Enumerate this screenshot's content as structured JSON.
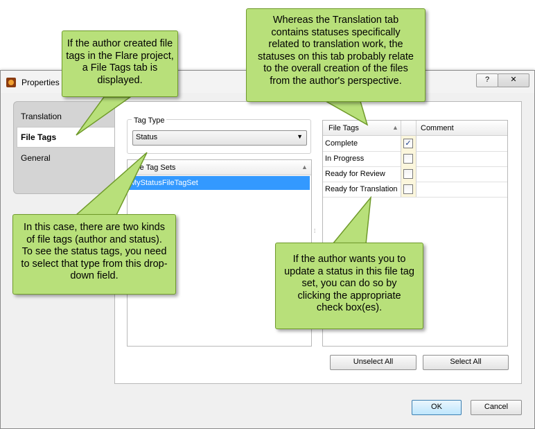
{
  "window": {
    "title": "Properties",
    "help_label": "?",
    "close_label": "✕"
  },
  "tabs": [
    {
      "label": "Translation"
    },
    {
      "label": "File Tags"
    },
    {
      "label": "General"
    }
  ],
  "tag_type": {
    "legend": "Tag Type",
    "selected": "Status"
  },
  "file_tag_sets": {
    "header": "File Tag Sets",
    "items": [
      "MyStatusFileTagSet"
    ]
  },
  "file_tags_table": {
    "col_tags": "File Tags",
    "col_comment": "Comment",
    "rows": [
      {
        "name": "Complete",
        "checked": true
      },
      {
        "name": "In Progress",
        "checked": false
      },
      {
        "name": "Ready for Review",
        "checked": false
      },
      {
        "name": "Ready for Translation",
        "checked": false
      }
    ]
  },
  "buttons": {
    "unselect_all": "Unselect All",
    "select_all": "Select All",
    "ok": "OK",
    "cancel": "Cancel"
  },
  "callouts": {
    "file_tags_tab": "If the author created file tags in the Flare project, a File Tags tab is displayed.",
    "translation_tab": "Whereas the Translation tab contains statuses specifically related to translation work, the statuses on this tab probably relate to the overall creation of the files from the author's perspective.",
    "tag_type": "In this case, there are two kinds of file tags (author and status). To see the status tags, you need to select that type from this drop-down field.",
    "check_box": "If the author wants you to update a status in this file tag set, you can do so by clicking the appropriate check box(es)."
  },
  "colors": {
    "callout_fill": "#b8e07a",
    "callout_border": "#6f9a2a",
    "selection": "#3399ff"
  }
}
